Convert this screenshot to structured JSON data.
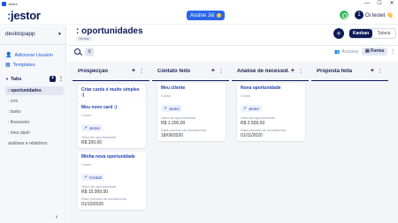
{
  "window": {
    "title": "Jestor",
    "controls": [
      "—",
      "☐",
      "✕"
    ]
  },
  "header": {
    "logo_colon": ":",
    "logo_text": "jestor",
    "assine_label": "Assine Já!",
    "whatsapp_icon": "whatsapp-icon",
    "user_initial": "1",
    "user_greeting": "Oi testet",
    "user_emoji": "👋"
  },
  "sidebar": {
    "workspace": "desktopapp",
    "links": [
      {
        "icon": "add-user-icon",
        "glyph": "👤",
        "label": "Adicionar Usuário"
      },
      {
        "icon": "templates-icon",
        "glyph": "▦",
        "label": "Templates"
      }
    ],
    "tabs_label": "Tabs",
    "tabs": [
      ": oportunidades",
      ": crm",
      ": tasks",
      ": financeiro",
      ": meu dash",
      "análises e relatórios"
    ],
    "active_tab_index": 0
  },
  "main": {
    "title": ": oportunidades",
    "badge": "Vendas",
    "views": {
      "kanban": "Kanban",
      "table": "Tabela"
    },
    "acessos": "Acessos",
    "forms": "Forms"
  },
  "board": {
    "columns": [
      {
        "title": "Prospecção",
        "cards": [
          {
            "title": "Criar cards é muito simples :)",
            "fields": []
          },
          {
            "title": "Meu novo card :)",
            "fields": [
              {
                "label": "Conta",
                "chip": "Jestor"
              },
              {
                "label": "Valor da oportunidade",
                "value": "R$ 200,00"
              }
            ]
          },
          {
            "title": "Minha nova oportunidade",
            "fields": [
              {
                "label": "Conta",
                "chip": "Conta2"
              },
              {
                "label": "Valor da oportunidade",
                "value": "R$ 15.009,00"
              },
              {
                "label": "Data prevista de fechamento",
                "value": "01/10/2020"
              }
            ]
          }
        ]
      },
      {
        "title": "Contato feito",
        "cards": [
          {
            "title": "Meu cliente",
            "fields": [
              {
                "label": "Conta",
                "chip": "Jestor"
              },
              {
                "label": "Valor da oportunidade",
                "value": "R$ 1.200,00"
              },
              {
                "label": "Data prevista de fechamento",
                "value": "18/09/2020"
              }
            ]
          }
        ]
      },
      {
        "title": "Análise de necessid...",
        "cards": [
          {
            "title": "Nova oportunidade",
            "fields": [
              {
                "label": "Conta",
                "chip": "Jestor"
              },
              {
                "label": "Valor da oportunidade",
                "value": "R$ 2.500,00"
              },
              {
                "label": "Data prevista de fechamento",
                "value": "01/11/2020"
              }
            ]
          }
        ]
      },
      {
        "title": "Proposta feita",
        "cards": []
      }
    ]
  }
}
